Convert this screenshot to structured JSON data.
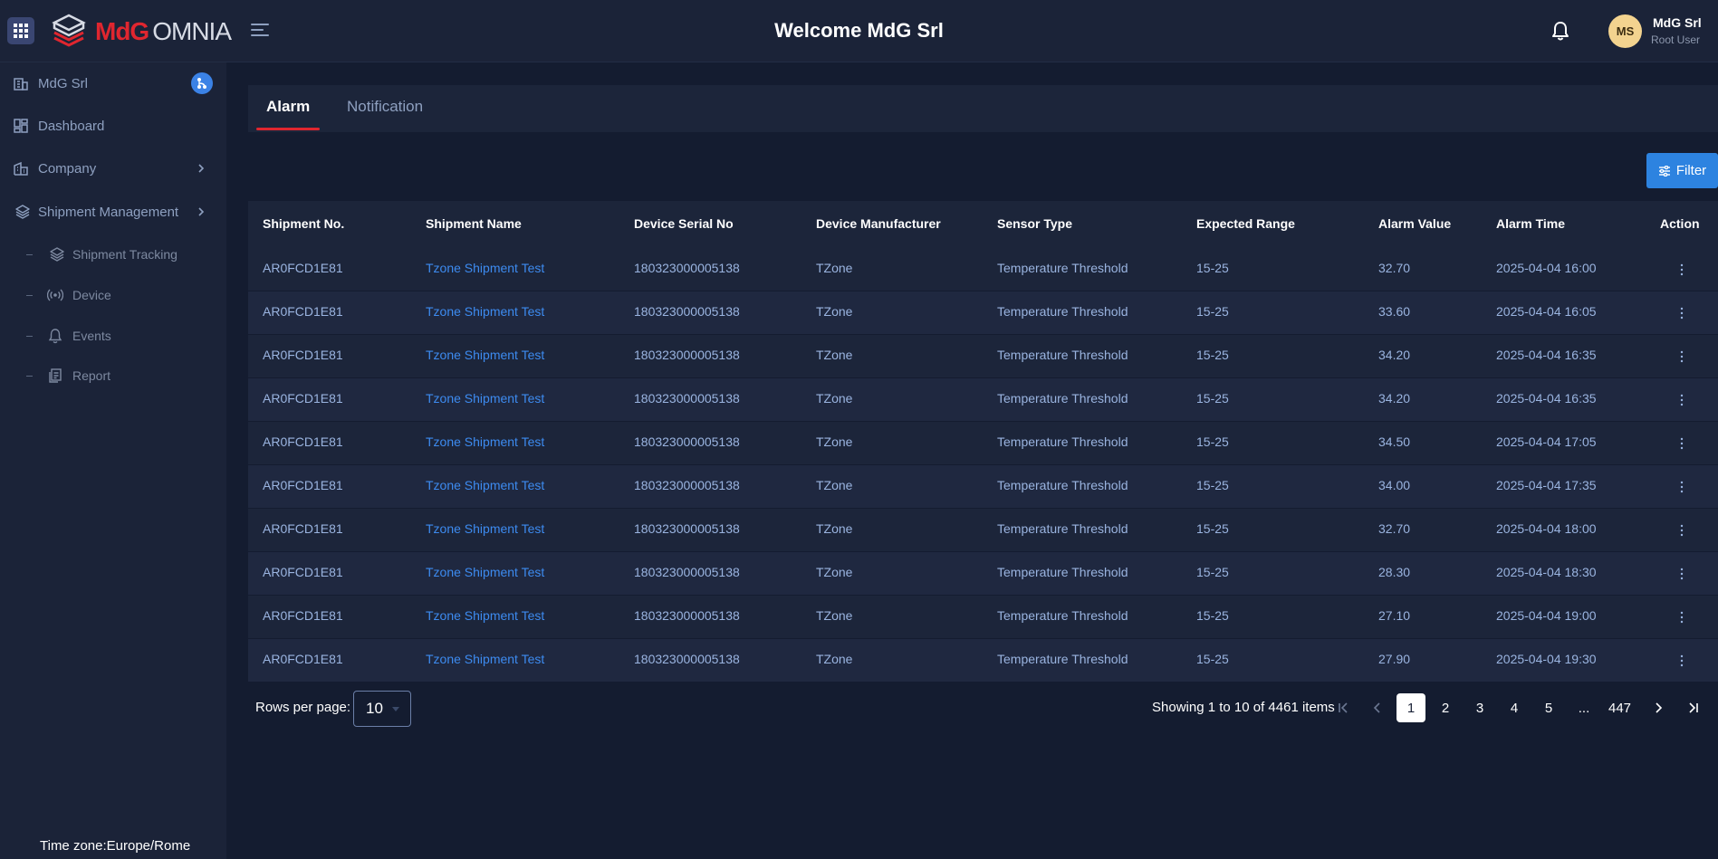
{
  "header": {
    "title": "Welcome MdG Srl",
    "logo_primary": "MdG",
    "logo_secondary": "OMNIA",
    "user_initials": "MS",
    "user_name": "MdG Srl",
    "user_role": "Root User"
  },
  "sidebar": {
    "items": [
      {
        "label": "MdG Srl",
        "icon": "building-icon"
      },
      {
        "label": "Dashboard",
        "icon": "dashboard-icon"
      },
      {
        "label": "Company",
        "icon": "company-icon"
      },
      {
        "label": "Shipment Management",
        "icon": "layers-icon"
      }
    ],
    "subitems": [
      {
        "label": "Shipment Tracking",
        "icon": "layers-icon"
      },
      {
        "label": "Device",
        "icon": "broadcast-icon"
      },
      {
        "label": "Events",
        "icon": "bell-icon"
      },
      {
        "label": "Report",
        "icon": "report-icon"
      }
    ],
    "timezone": "Time zone:Europe/Rome"
  },
  "tabs": [
    {
      "label": "Alarm",
      "active": true
    },
    {
      "label": "Notification",
      "active": false
    }
  ],
  "filter_label": "Filter",
  "table": {
    "columns": [
      "Shipment No.",
      "Shipment Name",
      "Device Serial No",
      "Device Manufacturer",
      "Sensor Type",
      "Expected Range",
      "Alarm Value",
      "Alarm Time",
      "Action"
    ],
    "rows": [
      [
        "AR0FCD1E81",
        "Tzone Shipment Test",
        "180323000005138",
        "TZone",
        "Temperature Threshold",
        "15-25",
        "32.70",
        "2025-04-04 16:00"
      ],
      [
        "AR0FCD1E81",
        "Tzone Shipment Test",
        "180323000005138",
        "TZone",
        "Temperature Threshold",
        "15-25",
        "33.60",
        "2025-04-04 16:05"
      ],
      [
        "AR0FCD1E81",
        "Tzone Shipment Test",
        "180323000005138",
        "TZone",
        "Temperature Threshold",
        "15-25",
        "34.20",
        "2025-04-04 16:35"
      ],
      [
        "AR0FCD1E81",
        "Tzone Shipment Test",
        "180323000005138",
        "TZone",
        "Temperature Threshold",
        "15-25",
        "34.20",
        "2025-04-04 16:35"
      ],
      [
        "AR0FCD1E81",
        "Tzone Shipment Test",
        "180323000005138",
        "TZone",
        "Temperature Threshold",
        "15-25",
        "34.50",
        "2025-04-04 17:05"
      ],
      [
        "AR0FCD1E81",
        "Tzone Shipment Test",
        "180323000005138",
        "TZone",
        "Temperature Threshold",
        "15-25",
        "34.00",
        "2025-04-04 17:35"
      ],
      [
        "AR0FCD1E81",
        "Tzone Shipment Test",
        "180323000005138",
        "TZone",
        "Temperature Threshold",
        "15-25",
        "32.70",
        "2025-04-04 18:00"
      ],
      [
        "AR0FCD1E81",
        "Tzone Shipment Test",
        "180323000005138",
        "TZone",
        "Temperature Threshold",
        "15-25",
        "28.30",
        "2025-04-04 18:30"
      ],
      [
        "AR0FCD1E81",
        "Tzone Shipment Test",
        "180323000005138",
        "TZone",
        "Temperature Threshold",
        "15-25",
        "27.10",
        "2025-04-04 19:00"
      ],
      [
        "AR0FCD1E81",
        "Tzone Shipment Test",
        "180323000005138",
        "TZone",
        "Temperature Threshold",
        "15-25",
        "27.90",
        "2025-04-04 19:30"
      ]
    ]
  },
  "pagination": {
    "rows_label": "Rows per page:",
    "rows_value": "10",
    "showing": "Showing 1 to 10 of 4461 items",
    "pages": [
      "1",
      "2",
      "3",
      "4",
      "5",
      "...",
      "447"
    ],
    "active_page": "1"
  },
  "colors": {
    "accent": "#2d83e0",
    "brand_red": "#e0262f",
    "background": "#141c30",
    "panel": "#1b2338"
  }
}
